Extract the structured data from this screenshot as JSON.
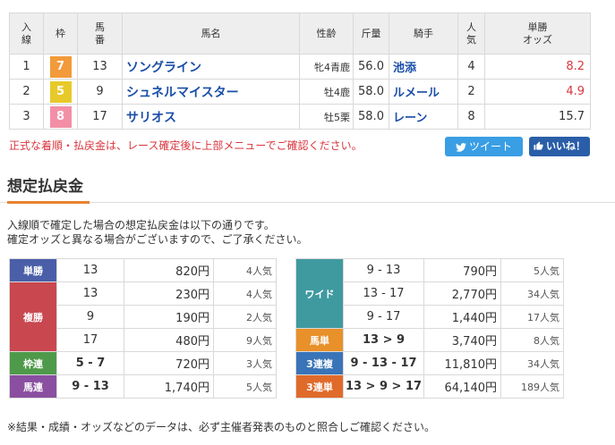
{
  "results": {
    "headers": {
      "rank": "入\n線",
      "frame": "枠",
      "number": "馬\n番",
      "horse": "馬名",
      "sexage": "性齢",
      "weight": "斤量",
      "jockey": "騎手",
      "popularity": "人\n気",
      "odds": "単勝\nオッズ"
    },
    "rows": [
      {
        "rank": "1",
        "frame": "7",
        "frame_color": "#f39a3a",
        "number": "13",
        "horse": "ソングライン",
        "sexage": "牝4青鹿",
        "weight": "56.0",
        "jockey": "池添",
        "popularity": "4",
        "odds": "8.2",
        "odds_red": true
      },
      {
        "rank": "2",
        "frame": "5",
        "frame_color": "#e8c92a",
        "number": "9",
        "horse": "シュネルマイスター",
        "sexage": "牡4鹿",
        "weight": "58.0",
        "jockey": "ルメール",
        "popularity": "2",
        "odds": "4.9",
        "odds_red": true
      },
      {
        "rank": "3",
        "frame": "8",
        "frame_color": "#f28fa6",
        "number": "17",
        "horse": "サリオス",
        "sexage": "牡5栗",
        "weight": "58.0",
        "jockey": "レーン",
        "popularity": "8",
        "odds": "15.7",
        "odds_red": false
      }
    ]
  },
  "notice": "正式な着順・払戻金は、レース確定後に上部メニューでご確認ください。",
  "social": {
    "tweet_label": "ツイート",
    "like_label": "いいね！"
  },
  "section_title": "想定払戻金",
  "intro": {
    "line1": "入線順で確定した場合の想定払戻金は以下の通りです。",
    "line2": "確定オッズと異なる場合がございますので、ご了承ください。"
  },
  "payout_left": [
    {
      "type": "単勝",
      "color": "#4a5fa8",
      "rows": [
        {
          "combo": "13",
          "amount": "820円",
          "pop": "4人気"
        }
      ]
    },
    {
      "type": "複勝",
      "color": "#c9474f",
      "rows": [
        {
          "combo": "13",
          "amount": "230円",
          "pop": "4人気"
        },
        {
          "combo": "9",
          "amount": "190円",
          "pop": "2人気"
        },
        {
          "combo": "17",
          "amount": "480円",
          "pop": "9人気"
        }
      ]
    },
    {
      "type": "枠連",
      "color": "#4f9a4a",
      "rows": [
        {
          "combo": "5 - 7",
          "amount": "720円",
          "pop": "3人気"
        }
      ]
    },
    {
      "type": "馬連",
      "color": "#8a4fa0",
      "rows": [
        {
          "combo": "9 - 13",
          "amount": "1,740円",
          "pop": "5人気"
        }
      ]
    }
  ],
  "payout_right": [
    {
      "type": "ワイド",
      "color": "#3f9aa0",
      "rows": [
        {
          "combo": "9 - 13",
          "amount": "790円",
          "pop": "5人気"
        },
        {
          "combo": "13 - 17",
          "amount": "2,770円",
          "pop": "34人気"
        },
        {
          "combo": "9 - 17",
          "amount": "1,440円",
          "pop": "17人気"
        }
      ]
    },
    {
      "type": "馬単",
      "color": "#e8902a",
      "rows": [
        {
          "combo": "13 > 9",
          "amount": "3,740円",
          "pop": "8人気"
        }
      ]
    },
    {
      "type": "3連複",
      "color": "#3a74b8",
      "rows": [
        {
          "combo": "9 - 13 - 17",
          "amount": "11,810円",
          "pop": "34人気"
        }
      ]
    },
    {
      "type": "3連単",
      "color": "#e06a2a",
      "rows": [
        {
          "combo": "13 > 9 > 17",
          "amount": "64,140円",
          "pop": "189人気"
        }
      ]
    }
  ],
  "footer_note": "※結果・成績・オッズなどのデータは、必ず主催者発表のものと照合しご確認ください。"
}
